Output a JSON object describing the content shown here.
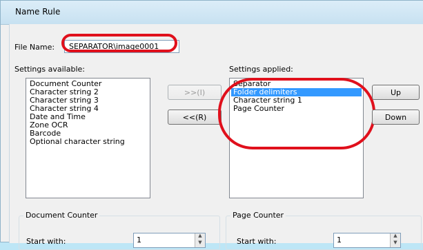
{
  "window": {
    "title": "Name Rule"
  },
  "file_name": {
    "label": "File Name:",
    "value": "SEPARATOR\\image0001"
  },
  "settings_available": {
    "label": "Settings available:",
    "items": [
      "Document Counter",
      "Character string 2",
      "Character string 3",
      "Character string 4",
      "Date and Time",
      "Zone OCR",
      "Barcode",
      "Optional character string"
    ]
  },
  "settings_applied": {
    "label": "Settings applied:",
    "items": [
      "Separator",
      "Folder delimiters",
      "Character string 1",
      "Page Counter"
    ],
    "selected": "Folder delimiters"
  },
  "buttons": {
    "add": ">>(I)",
    "remove": "<<(R)",
    "up": "Up",
    "down": "Down"
  },
  "document_counter": {
    "title": "Document Counter",
    "start_label": "Start with:",
    "start_value": "1"
  },
  "page_counter": {
    "title": "Page Counter",
    "start_label": "Start with:",
    "start_value": "1"
  },
  "colors": {
    "highlight": "#e0101c",
    "selection": "#3399ff",
    "background": "#bde6f6"
  }
}
